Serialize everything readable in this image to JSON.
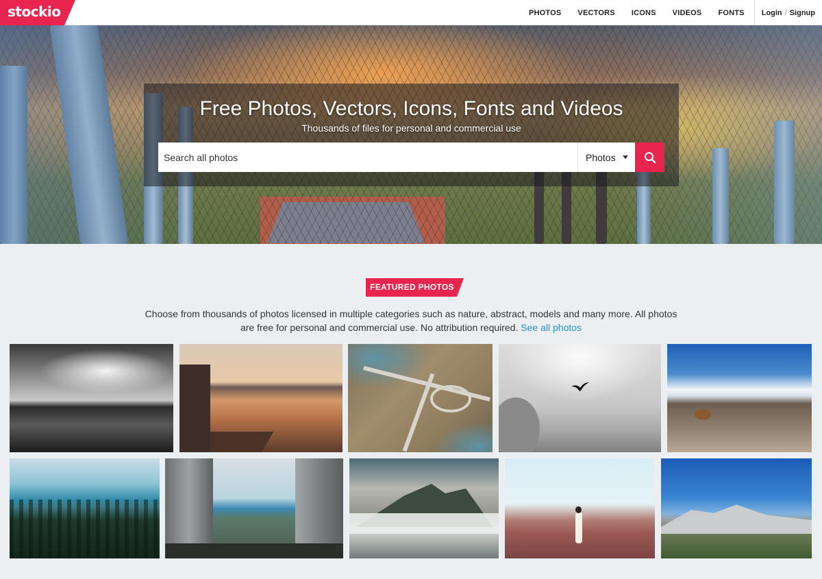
{
  "logo": {
    "text": "stockio"
  },
  "nav": {
    "links": [
      "PHOTOS",
      "VECTORS",
      "ICONS",
      "VIDEOS",
      "FONTS"
    ],
    "login": "Login",
    "separator": "/",
    "signup": "Signup"
  },
  "hero": {
    "title": "Free Photos, Vectors, Icons, Fonts and Videos",
    "subtitle": "Thousands of files for personal and commercial use",
    "search_placeholder": "Search all photos",
    "search_type": "Photos"
  },
  "featured": {
    "badge": "FEATURED PHOTOS",
    "description": "Choose from thousands of photos licensed in multiple categories such as nature, abstract, models and many more. All photos are free for personal and commercial use. No attribution required.",
    "link": "See all photos"
  },
  "photos": [
    "black-and-white-sea",
    "sunset-lake-pier",
    "highway-interchange-aerial",
    "bird-in-cloudy-sky",
    "volcanic-landscape",
    "forest-and-lake",
    "buildings-and-sea",
    "misty-mountain",
    "woman-in-desert",
    "mountain-blue-sky"
  ],
  "colors": {
    "accent": "#e8254f",
    "link": "#2b8fd6",
    "background": "#ebeff1"
  }
}
